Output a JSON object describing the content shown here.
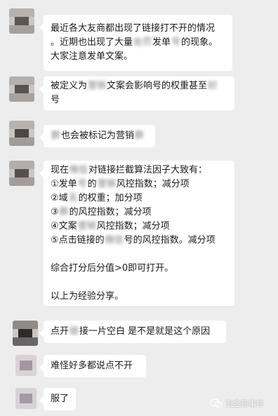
{
  "messages": [
    {
      "lines": [
        "最近各大友商都出现了链接打不开的情况",
        "。近期也出现了大量处罚发单号的现象。",
        "大家注意发单文案。"
      ]
    },
    {
      "lines": [
        "被定义为营销文案会影响号的权重甚至封",
        "号"
      ]
    },
    {
      "lines": [
        "群也会被标记为营销群"
      ]
    },
    {
      "lines": [
        "现在微信对链接拦截算法因子大致有：",
        "①发单号的营销风控指数；减分项",
        "②域名的权重；加分项",
        "③群的风控指数；减分项",
        "④文案营销风控指数；减分项",
        "⑤点击链接的微信号的风控指数。减分项",
        "",
        "综合打分后分值>0即可打开。",
        "",
        "以上为经验分享。"
      ]
    },
    {
      "lines": [
        "点开链接一片空白 是不是就是这个原因"
      ]
    },
    {
      "lines": [
        "难怪好多都说点不开"
      ]
    },
    {
      "lines": [
        "服了"
      ]
    }
  ],
  "watermark": {
    "text": "淘金新事件",
    "icon": "wechat-official-account-icon"
  },
  "colors": {
    "background": "#ededed",
    "bubble": "#ffffff",
    "text": "#1a1a1a"
  }
}
